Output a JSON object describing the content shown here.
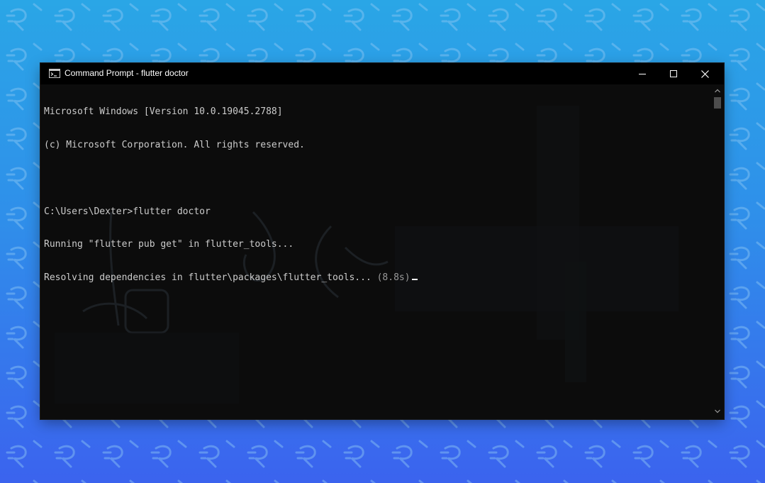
{
  "window": {
    "title": "Command Prompt - flutter  doctor",
    "controls": {
      "minimize_icon": "minimize-icon",
      "maximize_icon": "maximize-icon",
      "close_icon": "close-icon"
    }
  },
  "console": {
    "lines": [
      "Microsoft Windows [Version 10.0.19045.2788]",
      "(c) Microsoft Corporation. All rights reserved.",
      "",
      "C:\\Users\\Dexter>flutter doctor",
      "Running \"flutter pub get\" in flutter_tools...",
      "Resolving dependencies in flutter\\packages\\flutter_tools..."
    ],
    "elapsed": " (8.8s)"
  },
  "colors": {
    "wallpaper_top": "#2aa6e6",
    "wallpaper_bottom": "#3b63ee",
    "terminal_bg": "#0c0c0c",
    "terminal_text": "#cccccc",
    "titlebar_bg": "#000000"
  }
}
